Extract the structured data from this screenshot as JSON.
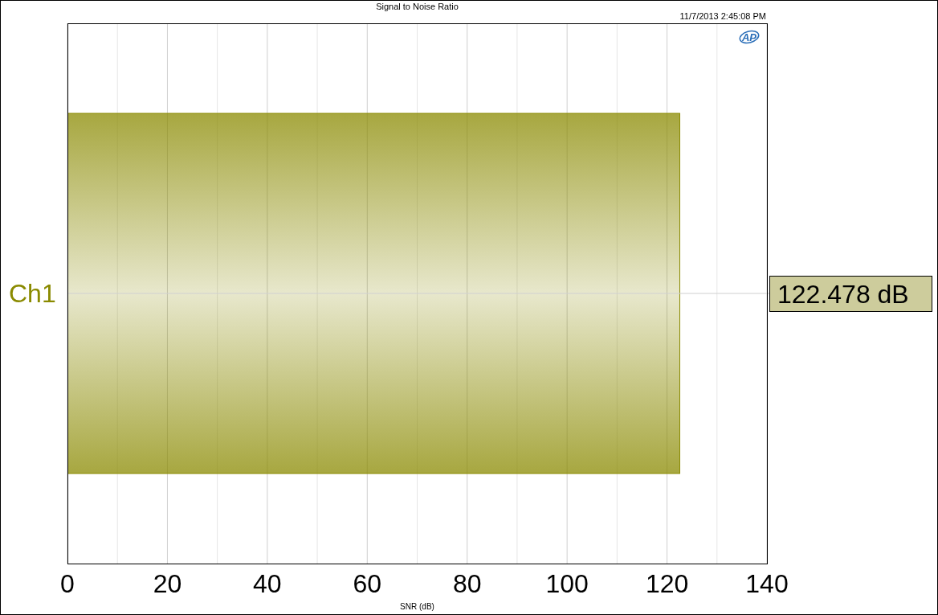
{
  "title": "Signal to Noise Ratio",
  "timestamp": "11/7/2013 2:45:08 PM",
  "logo": {
    "text": "AP"
  },
  "chart": {
    "value_label": "122.478 dB",
    "chart_data": {
      "type": "bar",
      "orientation": "horizontal",
      "xlabel": "SNR (dB)",
      "categories": [
        "Ch1"
      ],
      "series": [
        {
          "color": "#8a8a00",
          "values": [
            122.478
          ]
        }
      ],
      "grid": true,
      "ref_lines": [
        {
          "axis": "y",
          "value": "Ch1"
        }
      ],
      "xlim": [
        0,
        140
      ],
      "xticks": [
        0,
        20,
        40,
        60,
        80,
        100,
        120,
        140
      ]
    }
  }
}
